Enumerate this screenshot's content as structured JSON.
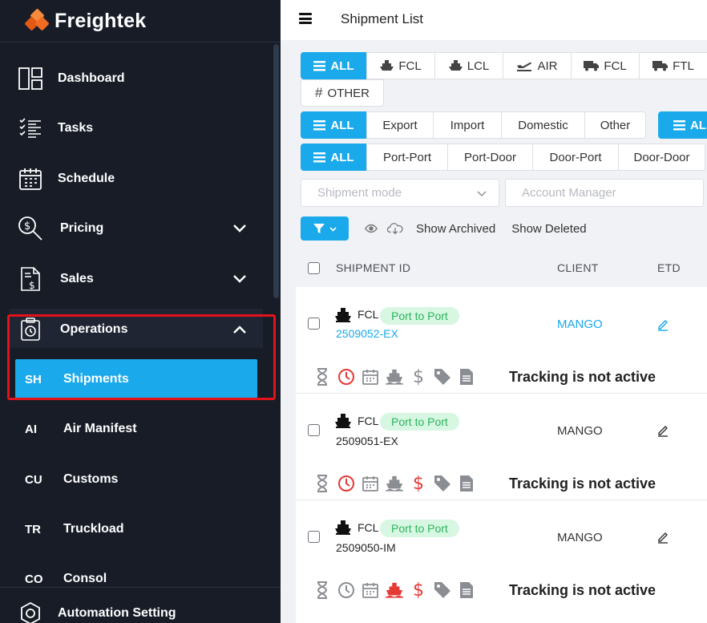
{
  "brand": {
    "name": "Freightek"
  },
  "sidebar": {
    "items": [
      {
        "label": "Dashboard",
        "icon": "dashboard-icon"
      },
      {
        "label": "Tasks",
        "icon": "tasks-icon"
      },
      {
        "label": "Schedule",
        "icon": "calendar-icon"
      },
      {
        "label": "Pricing",
        "icon": "pricing-icon"
      },
      {
        "label": "Sales",
        "icon": "sales-icon"
      },
      {
        "label": "Operations",
        "icon": "operations-icon"
      }
    ],
    "sub_items": [
      {
        "abbr": "SH",
        "label": "Shipments",
        "active": true
      },
      {
        "abbr": "AI",
        "label": "Air Manifest"
      },
      {
        "abbr": "CU",
        "label": "Customs"
      },
      {
        "abbr": "TR",
        "label": "Truckload"
      },
      {
        "abbr": "CO",
        "label": "Consol"
      }
    ],
    "bottom": {
      "label": "Automation Setting"
    }
  },
  "header": {
    "title": "Shipment List"
  },
  "mode_filters": [
    "ALL",
    "FCL",
    "LCL",
    "AIR",
    "FCL",
    "FTL",
    "OTHER"
  ],
  "direction_filters": [
    "ALL",
    "Export",
    "Import",
    "Domestic",
    "Other",
    "ALL"
  ],
  "service_filters": [
    "ALL",
    "Port-Port",
    "Port-Door",
    "Door-Port",
    "Door-Door"
  ],
  "inputs": {
    "shipment_mode_placeholder": "Shipment mode",
    "account_manager_placeholder": "Account Manager"
  },
  "toolbar": {
    "show_archived": "Show Archived",
    "show_deleted": "Show Deleted"
  },
  "table": {
    "columns": [
      "SHIPMENT ID",
      "CLIENT",
      "ETD"
    ],
    "rows": [
      {
        "mode": "FCL",
        "badge": "Port to Port",
        "id": "2509052-EX",
        "client": "MANGO",
        "status": "Tracking is not active",
        "highlight": true
      },
      {
        "mode": "FCL",
        "badge": "Port to Port",
        "id": "2509051-EX",
        "client": "MANGO",
        "status": "Tracking is not active"
      },
      {
        "mode": "FCL",
        "badge": "Port to Port",
        "id": "2509050-IM",
        "client": "MANGO",
        "status": "Tracking is not active"
      }
    ]
  },
  "colors": {
    "accent": "#1aa9ea",
    "sidebar_bg": "#171c27",
    "alert": "#e53935",
    "badge_bg": "#d8f7e2",
    "badge_text": "#2ab55d"
  }
}
